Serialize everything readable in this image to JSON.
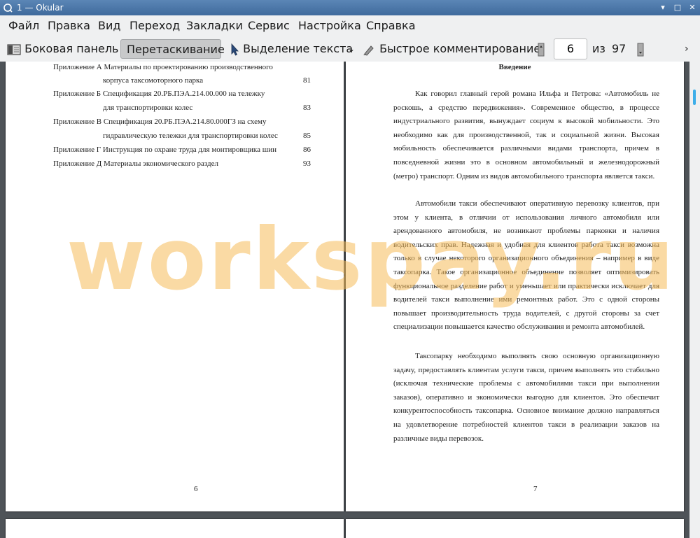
{
  "window": {
    "title": "1 — Okular"
  },
  "menu": [
    "Файл",
    "Правка",
    "Вид",
    "Переход",
    "Закладки",
    "Сервис",
    "Настройка",
    "Справка"
  ],
  "toolbar": {
    "sidebar_label": "Боковая панель",
    "drag_label": "Перетаскивание",
    "select_text_label": "Выделение текста",
    "quick_comment_label": "Быстрое комментирование",
    "page_current": "6",
    "page_of": "из",
    "page_total": "97"
  },
  "left_page": {
    "toc": [
      {
        "text": "Приложение А Материалы по проектированию производственного",
        "page": ""
      },
      {
        "text": "корпуса таксомоторного парка",
        "page": "81"
      },
      {
        "text": "Приложение Б Спецификация 20.РБ.ПЭА.214.00.000 на тележку",
        "page": ""
      },
      {
        "text": "для транспортировки колес",
        "page": "83"
      },
      {
        "text": "Приложение В Спецификация 20.РБ.ПЭА.214.80.000ГЗ на схему",
        "page": ""
      },
      {
        "text": "гидравлическую тележки для транспортировки колес",
        "page": "85"
      },
      {
        "text": "Приложение Г Инструкция по охране труда для монтировщика шин",
        "page": "86"
      },
      {
        "text": "Приложение Д Материалы экономического раздел",
        "page": "93"
      }
    ],
    "page_number": "6"
  },
  "right_page": {
    "heading": "Введение",
    "paragraphs": [
      "Как говорил главный герой романа Ильфа и Петрова: «Автомобиль не роскошь, а средство передвижения». Современное общество, в процессе индустриального развития, вынуждает социум к высокой мобильности. Это необходимо как для производственной, так и социальной жизни. Высокая мобильность обеспечивается различными видами транспорта, причем в повседневной жизни это в основном автомобильный и железнодорожный (метро) транспорт. Одним из видов автомобильного транспорта является такси.",
      "Автомобили такси обеспечивают оперативную перевозку клиентов, при этом у клиента, в отличии от использования личного автомобиля или арендованного автомобиля, не возникают проблемы парковки и наличия водительских прав. Надежная и удобная для клиентов работа такси возможна только в случае некоторого организационного объединения – например в виде таксопарка. Такое организационное объединение позволяет оптимизировать функциональное разделение работ и уменьшает или практически исключает для водителей такси выполнение ими ремонтных работ. Это с одной стороны повышает производительность труда водителей, с другой стороны за счет специализации повышается качество обслуживания и ремонта автомобилей.",
      "Таксопарку необходимо выполнять свою основную организационную задачу, предоставлять клиентам услуги такси, причем выполнять это стабильно (исключая технические проблемы с автомобилями такси при выполнении заказов), оперативно и экономически выгодно для клиентов. Это обеспечит конкурентоспособность таксопарка. Основное внимание должно направляться на удовлетворение потребностей клиентов такси в реализации заказов на различные виды перевозок."
    ],
    "page_number": "7"
  },
  "watermark": "workspay.ru",
  "colors": {
    "titlebar": "#4a76a8",
    "toolbar_bg": "#eff0f1",
    "viewport_bg": "#4e5358",
    "watermark": "#f5bc5a"
  }
}
